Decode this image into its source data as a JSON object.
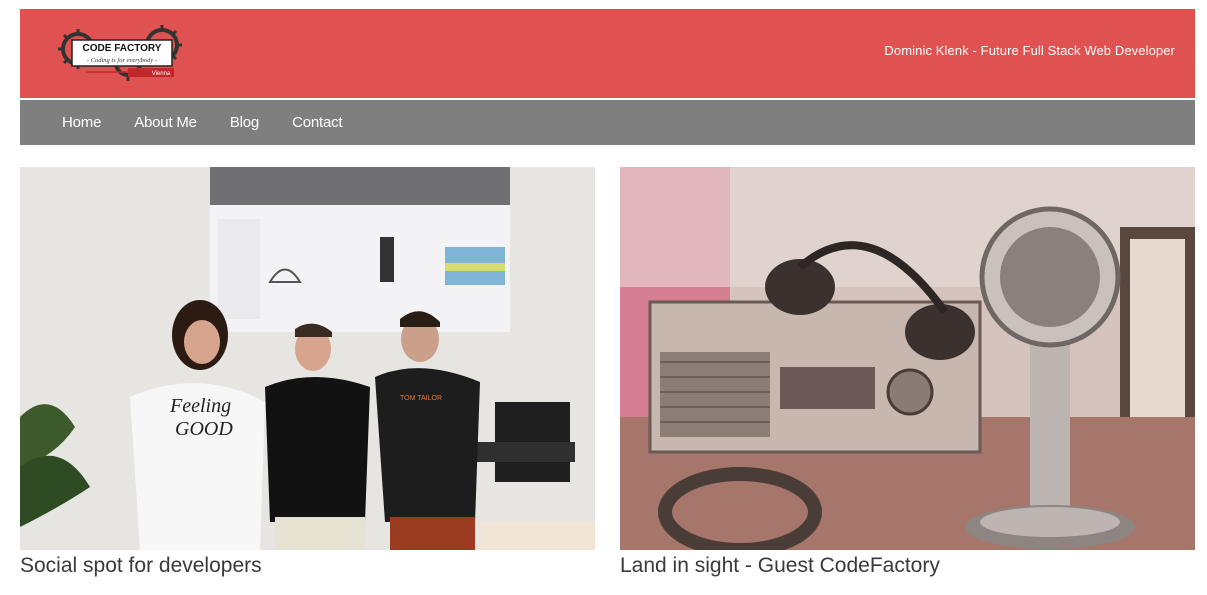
{
  "header": {
    "logo": {
      "line1": "CODE FACTORY",
      "line2": "- Coding is for everybody -",
      "line3": "Vienna"
    },
    "tagline": "Dominic Klenk - Future Full Stack Web Developer"
  },
  "nav": {
    "items": [
      {
        "label": "Home"
      },
      {
        "label": "About Me"
      },
      {
        "label": "Blog"
      },
      {
        "label": "Contact"
      }
    ]
  },
  "posts": [
    {
      "caption": "Social spot for developers",
      "image": "group-photo-three-people-in-front-of-projector"
    },
    {
      "caption": "Land in sight - Guest CodeFactory",
      "image": "vintage-radio-and-microphone"
    }
  ],
  "colors": {
    "header_bg": "#e05252",
    "nav_bg": "#7f7f7f",
    "caption_text": "#3a3a3a"
  }
}
